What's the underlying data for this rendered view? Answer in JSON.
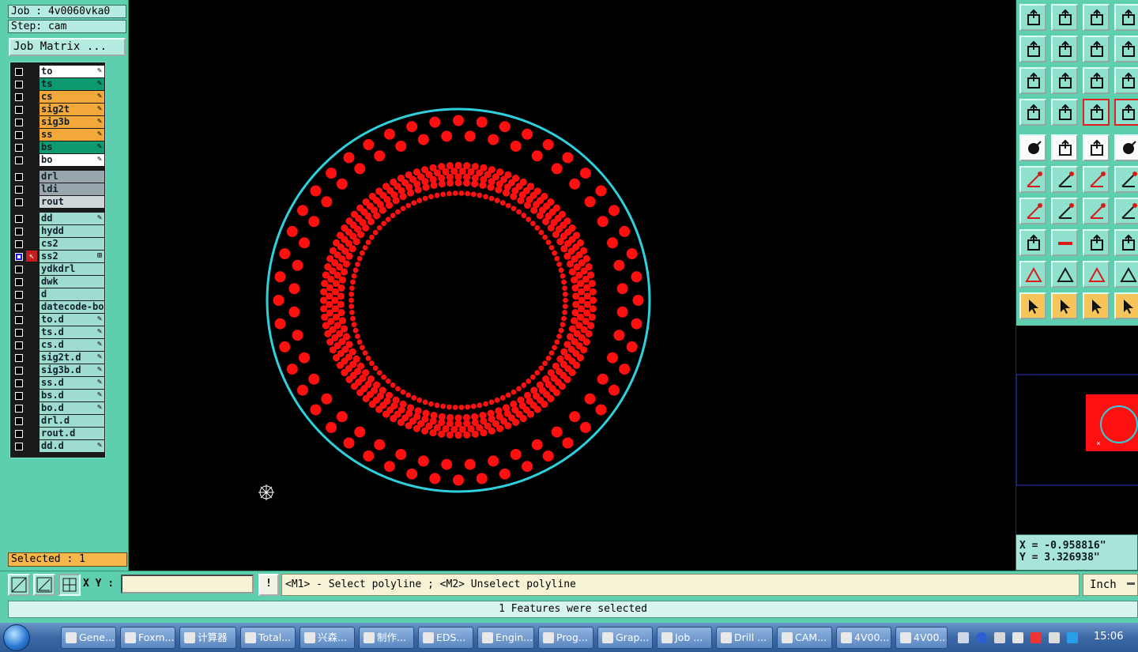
{
  "job": {
    "job_text": "Job : 4v0060vka0",
    "step_text": "Step: cam",
    "matrix_btn": "Job Matrix ..."
  },
  "layers": [
    {
      "name": "to",
      "color": "white",
      "mark": "✎"
    },
    {
      "name": "ts",
      "color": "green",
      "mark": "✎"
    },
    {
      "name": "cs",
      "color": "orange",
      "mark": "✎"
    },
    {
      "name": "sig2t",
      "color": "orange",
      "mark": "✎"
    },
    {
      "name": "sig3b",
      "color": "orange",
      "mark": "✎"
    },
    {
      "name": "ss",
      "color": "orange",
      "mark": "✎"
    },
    {
      "name": "bs",
      "color": "green",
      "mark": "✎"
    },
    {
      "name": "bo",
      "color": "white",
      "mark": "✎"
    },
    {
      "name": "drl",
      "color": "gray",
      "mark": ""
    },
    {
      "name": "ldi",
      "color": "gray",
      "mark": ""
    },
    {
      "name": "rout",
      "color": "lgray",
      "mark": ""
    },
    {
      "name": "dd",
      "color": "teal",
      "mark": "✎"
    },
    {
      "name": "hydd",
      "color": "teal",
      "mark": ""
    },
    {
      "name": "cs2",
      "color": "teal",
      "mark": ""
    },
    {
      "name": "ss2",
      "color": "teal",
      "mark": "⊞",
      "active": true
    },
    {
      "name": "ydkdrl",
      "color": "teal",
      "mark": ""
    },
    {
      "name": "dwk",
      "color": "teal",
      "mark": ""
    },
    {
      "name": "d",
      "color": "teal",
      "mark": ""
    },
    {
      "name": "datecode-bo",
      "color": "teal",
      "mark": ""
    },
    {
      "name": "to.d",
      "color": "teal",
      "mark": "✎"
    },
    {
      "name": "ts.d",
      "color": "teal",
      "mark": "✎"
    },
    {
      "name": "cs.d",
      "color": "teal",
      "mark": "✎"
    },
    {
      "name": "sig2t.d",
      "color": "teal",
      "mark": "✎"
    },
    {
      "name": "sig3b.d",
      "color": "teal",
      "mark": "✎"
    },
    {
      "name": "ss.d",
      "color": "teal",
      "mark": "✎"
    },
    {
      "name": "bs.d",
      "color": "teal",
      "mark": "✎"
    },
    {
      "name": "bo.d",
      "color": "teal",
      "mark": "✎"
    },
    {
      "name": "drl.d",
      "color": "teal",
      "mark": ""
    },
    {
      "name": "rout.d",
      "color": "teal",
      "mark": ""
    },
    {
      "name": "dd.d",
      "color": "teal",
      "mark": "✎"
    }
  ],
  "selected_text": "Selected : 1",
  "canvas": {
    "outline_color": "#2fd0dc",
    "pad_color": "#ff1010",
    "rings": [
      {
        "count": 48,
        "radius_frac": 0.94
      },
      {
        "count": 44,
        "radius_frac": 0.86
      },
      {
        "count": 100,
        "radius_frac": 0.705
      },
      {
        "count": 96,
        "radius_frac": 0.675
      },
      {
        "count": 92,
        "radius_frac": 0.645
      },
      {
        "count": 90,
        "radius_frac": 0.615
      },
      {
        "count": 110,
        "radius_frac": 0.56
      }
    ]
  },
  "coords": {
    "x_text": "X = -0.958816\"",
    "y_text": "Y = 3.326938\""
  },
  "command": {
    "xy_label": "X Y :",
    "xy_value": "",
    "warn": "!",
    "prompt": "<M1> - Select polyline ; <M2> Unselect polyline",
    "units": "Inch"
  },
  "status_text": "1 Features were selected",
  "toolbar_icons": [
    "close-all-icon",
    "save-icon",
    "home-icon",
    "layout-icon",
    "zoom-in-icon",
    "zoom-out-icon",
    "undo-icon",
    "snap-icon",
    "fit-icon",
    "fit-all-icon",
    "ratio-icon",
    "help-icon",
    "measure-icon",
    "grid-icon",
    "net-icon",
    "net-red-icon",
    "add-pad-icon",
    "add-surface-icon",
    "ruler-icon",
    "pad-icon",
    "connect-icon",
    "delete-icon",
    "line-icon",
    "line2-icon",
    "angle-icon",
    "slash-icon",
    "arc-icon",
    "split-icon",
    "move-icon",
    "minus-icon",
    "pad-move-icon",
    "group-icon",
    "triangle-icon",
    "triangle2-icon",
    "arch-icon",
    "arch2-icon",
    "select-icon",
    "select-box-icon",
    "select-poly-icon",
    "select-net-icon"
  ],
  "taskbar": {
    "items": [
      "Gene...",
      "Foxm...",
      "计算器",
      "Total...",
      "兴森...",
      "制作...",
      "EDS...",
      "Engin...",
      "Prog...",
      "Grap...",
      "Job ...",
      "Drill ...",
      "CAM...",
      "4V00...",
      "4V00..."
    ],
    "clock": "15:06"
  }
}
